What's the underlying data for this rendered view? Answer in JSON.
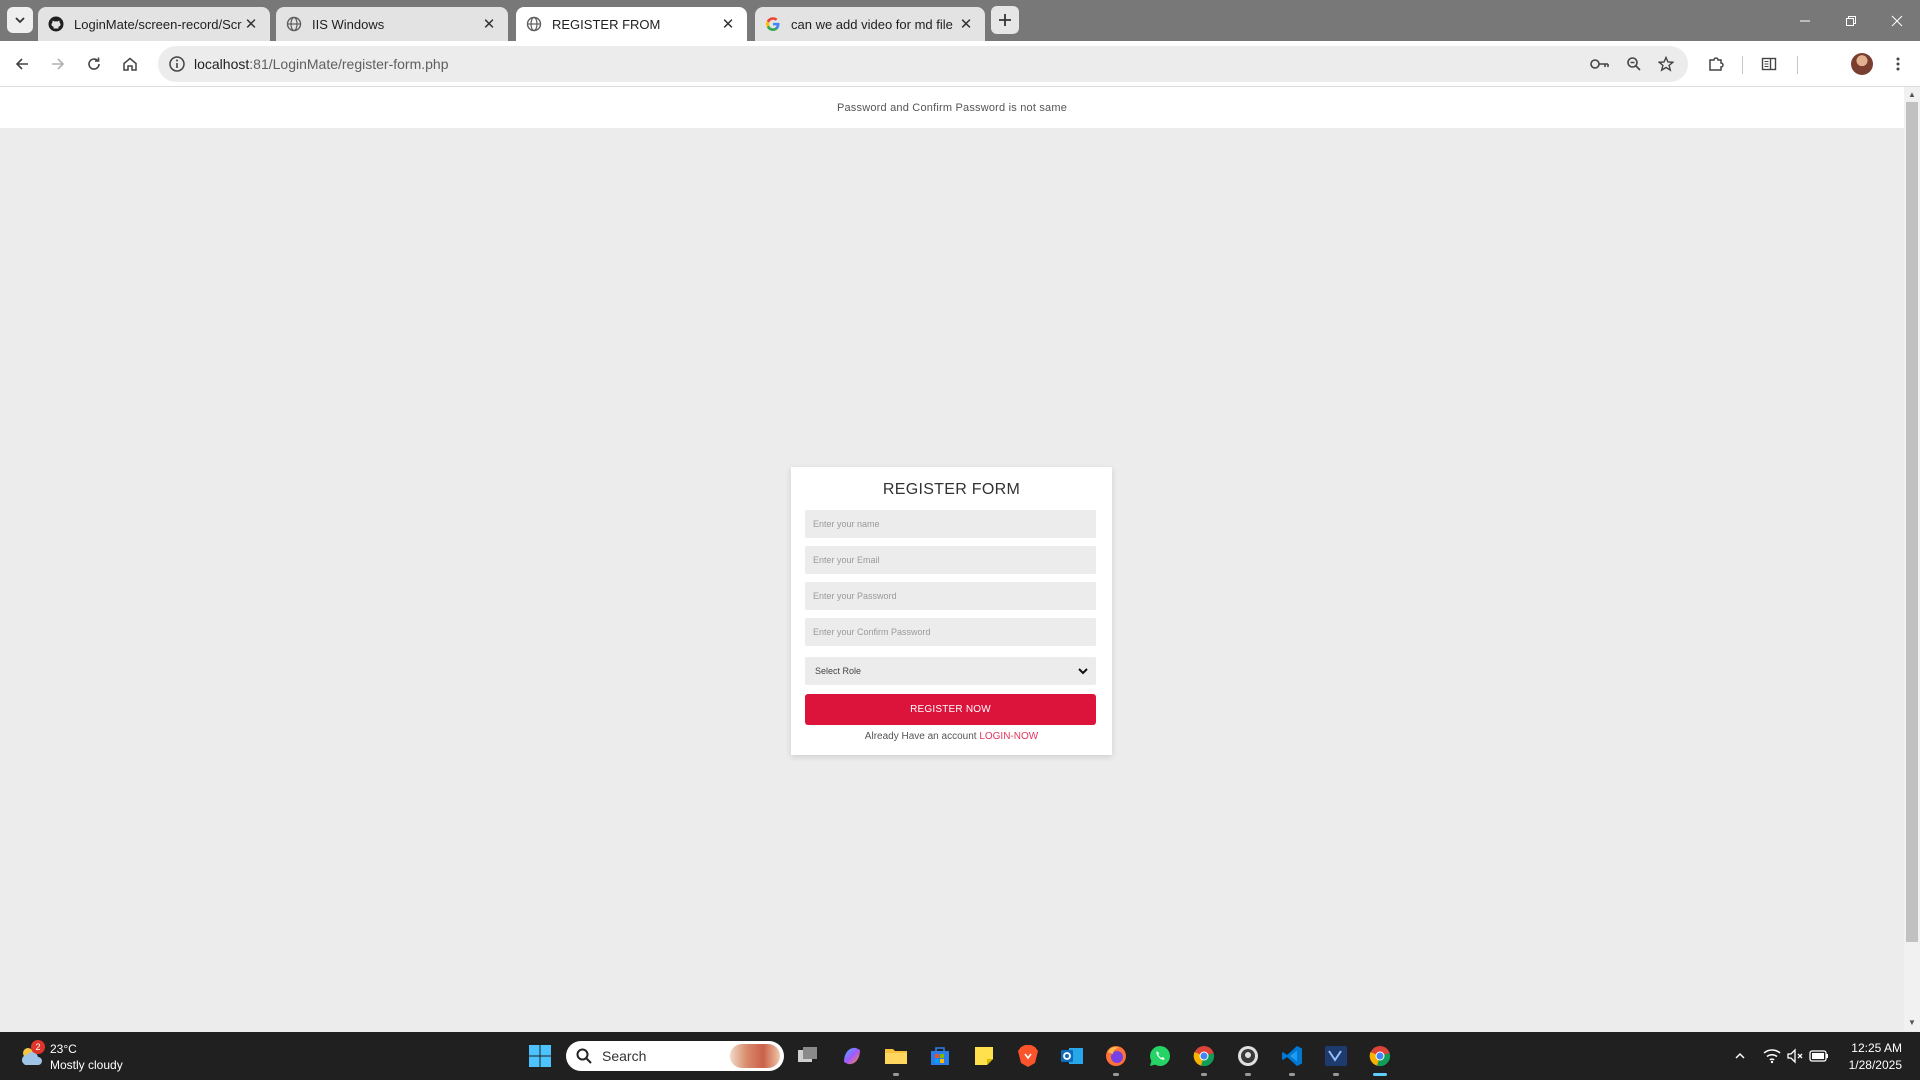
{
  "browser": {
    "tabs": [
      {
        "title": "LoginMate/screen-record/Scree",
        "favicon": "github-icon",
        "active": false
      },
      {
        "title": "IIS Windows",
        "favicon": "globe-icon",
        "active": false
      },
      {
        "title": "REGISTER FROM",
        "favicon": "globe-icon",
        "active": true
      },
      {
        "title": "can we add video for md file - G",
        "favicon": "google-icon",
        "active": false
      }
    ],
    "url_host": "localhost",
    "url_path": ":81/LoginMate/register-form.php"
  },
  "page": {
    "message": "Password and Confirm Password is not same",
    "form": {
      "title": "REGISTER FORM",
      "name_placeholder": "Enter your name",
      "email_placeholder": "Enter your Email",
      "password_placeholder": "Enter your Password",
      "confirm_placeholder": "Enter your Confirm Password",
      "role_selected": "Select Role",
      "submit_label": "REGISTER NOW",
      "footer_text": "Already Have an account",
      "footer_link": "LOGIN-NOW"
    },
    "accent_color": "#dc143c"
  },
  "taskbar": {
    "weather_badge": "2",
    "weather_temp": "23°C",
    "weather_condition": "Mostly cloudy",
    "search_label": "Search",
    "time": "12:25 AM",
    "date": "1/28/2025"
  }
}
